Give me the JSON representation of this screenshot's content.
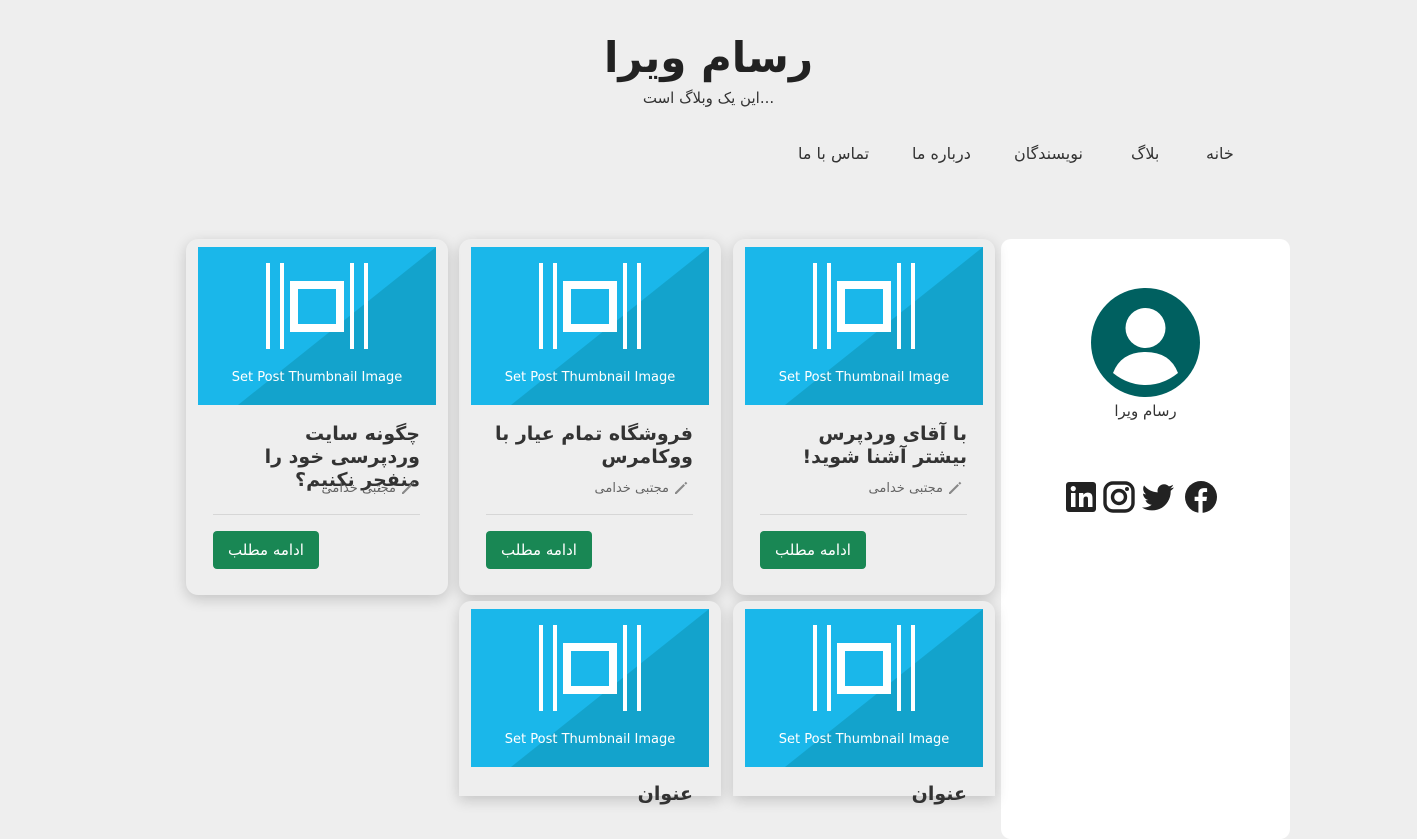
{
  "site": {
    "title": "رسام ویرا",
    "tagline": "این یک وبلاگ است..."
  },
  "nav": {
    "items": [
      "خانه",
      "بلاگ",
      "نویسندگان",
      "درباره ما",
      "تماس با ما"
    ]
  },
  "sidebar": {
    "author_name": "رسام ویرا",
    "social": [
      "facebook-icon",
      "twitter-icon",
      "instagram-icon",
      "linkedin-icon"
    ],
    "avatar_color": "#006060"
  },
  "thumbnail": {
    "caption": "Set Post Thumbnail Image",
    "color_light": "#1ab7ea",
    "color_dark": "#13a3cc"
  },
  "posts": [
    {
      "title": "با آقای وردپرس بیشتر آشنا شوید!",
      "author": "مجتبی خدامی",
      "read_more": "ادامه مطلب"
    },
    {
      "title": "فروشگاه تمام عیار با ووکامرس",
      "author": "مجتبی خدامی",
      "read_more": "ادامه مطلب"
    },
    {
      "title": "چگونه سایت وردپرسی خود را منفجر نکنیم؟",
      "author": "مجتبی خدامی",
      "read_more": "ادامه مطلب"
    },
    {
      "title": "عنوان",
      "author": "",
      "read_more": ""
    },
    {
      "title": "عنوان",
      "author": "",
      "read_more": ""
    }
  ],
  "colors": {
    "background": "#eeeeee",
    "button": "#198754",
    "text": "#333333"
  }
}
